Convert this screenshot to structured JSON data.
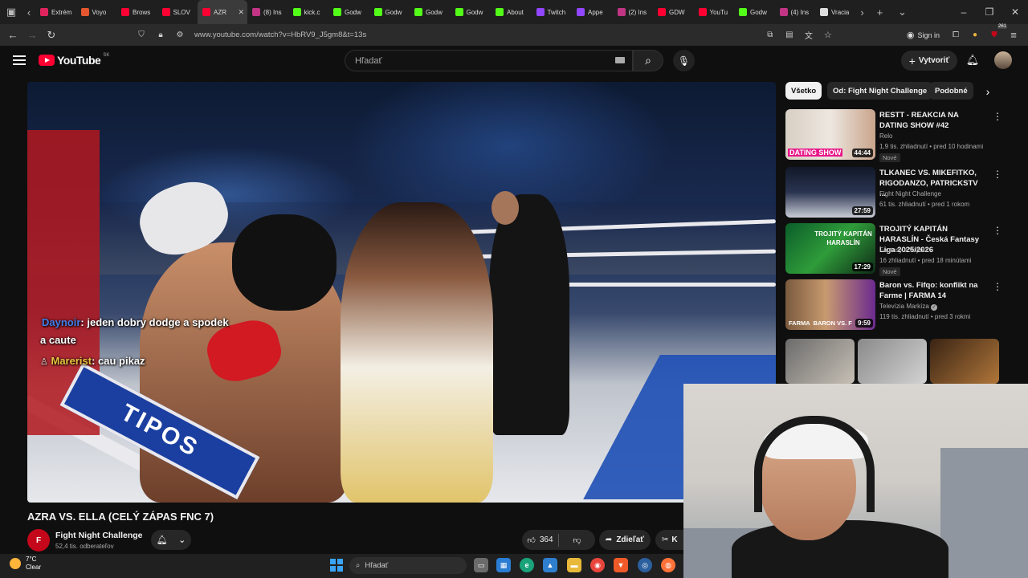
{
  "browser": {
    "tabs": [
      {
        "label": "Extrém",
        "color": "#e0245e"
      },
      {
        "label": "Voyo",
        "color": "#e4572e"
      },
      {
        "label": "Brows",
        "color": "#ff0033"
      },
      {
        "label": "SLOV",
        "color": "#ff0033"
      },
      {
        "label": "AZR",
        "color": "#ff0033",
        "active": true
      },
      {
        "label": "(8) Ins",
        "color": "#c13584"
      },
      {
        "label": "kick.c",
        "color": "#53fc18"
      },
      {
        "label": "Godw",
        "color": "#53fc18"
      },
      {
        "label": "Godw",
        "color": "#53fc18"
      },
      {
        "label": "Godw",
        "color": "#53fc18"
      },
      {
        "label": "Godw",
        "color": "#53fc18"
      },
      {
        "label": "About",
        "color": "#53fc18"
      },
      {
        "label": "Twitch",
        "color": "#9146ff"
      },
      {
        "label": "Appe",
        "color": "#9146ff"
      },
      {
        "label": "(2) Ins",
        "color": "#c13584"
      },
      {
        "label": "GDW",
        "color": "#ff0033"
      },
      {
        "label": "YouTu",
        "color": "#ff0033"
      },
      {
        "label": "Godw",
        "color": "#53fc18"
      },
      {
        "label": "(4) Ins",
        "color": "#c13584"
      },
      {
        "label": "Vracia",
        "color": "#dddddd"
      }
    ],
    "url": "www.youtube.com/watch?v=HbRV9_J5gm8&t=13s",
    "signin_label": "Sign in",
    "ext_badge": "261"
  },
  "youtube": {
    "logo_text": "YouTube",
    "country": "SK",
    "search_placeholder": "Hľadať",
    "create_label": "Vytvoriť",
    "chips": [
      "Všetko",
      "Od: Fight Night Challenge",
      "Podobné"
    ],
    "recommendations": [
      {
        "title": "RESTT - REAKCIA NA DATING SHOW #42",
        "channel": "Relo",
        "meta": "1,9 tis. zhliadnutí • pred 10 hodinami",
        "badge": "Nové",
        "duration": "44:44"
      },
      {
        "title": "TLKANEC VS. MIKEFITKO, RIGODANZO, PATRICKSTV ...",
        "channel": "Fight Night Challenge",
        "meta": "61 tis. zhliadnutí • pred 1 rokom",
        "badge": "",
        "duration": "27:59"
      },
      {
        "title": "TROJITÝ KAPITÁN HARASLÍN - Česká Fantasy Liga 2025/2026",
        "channel": "Fantasy s Vojtou",
        "meta": "16 zhliadnutí • pred 18 minútami",
        "badge": "Nové",
        "duration": "17:29"
      },
      {
        "title": "Baron vs. Fifqo: konflikt na Farme | FARMA 14",
        "channel": "Televízia Markíza",
        "meta": "119 tis. zhliadnutí • pred 3 rokmi",
        "badge": "",
        "duration": "9:59"
      }
    ],
    "thumb_texts": [
      "DATING SHOW",
      "",
      "TROJITÝ KAPITÁN HARASLÍN",
      "FARMA  BARON VS. F"
    ],
    "video": {
      "title": "AZRA VS. ELLA (CELÝ ZÁPAS FNC 7)",
      "channel": "Fight Night Challenge",
      "subscribers": "52,4 tis. odberateľov",
      "likes": "364",
      "share_label": "Zdieľať",
      "clip_label": "K",
      "banner_text": "TIPOS"
    },
    "chat": [
      {
        "user": "Daynoir",
        "text": ": jeden dobry dodge a spodek",
        "color": "#3f7ee8"
      },
      {
        "user": "",
        "text": "a caute",
        "color": "#ffffff"
      },
      {
        "user": "Marerist",
        "text": ": cau pikaz",
        "color": "#e8c33f"
      }
    ]
  },
  "taskbar": {
    "temp": "7°C",
    "weather": "Clear",
    "search_placeholder": "Hľadať"
  }
}
